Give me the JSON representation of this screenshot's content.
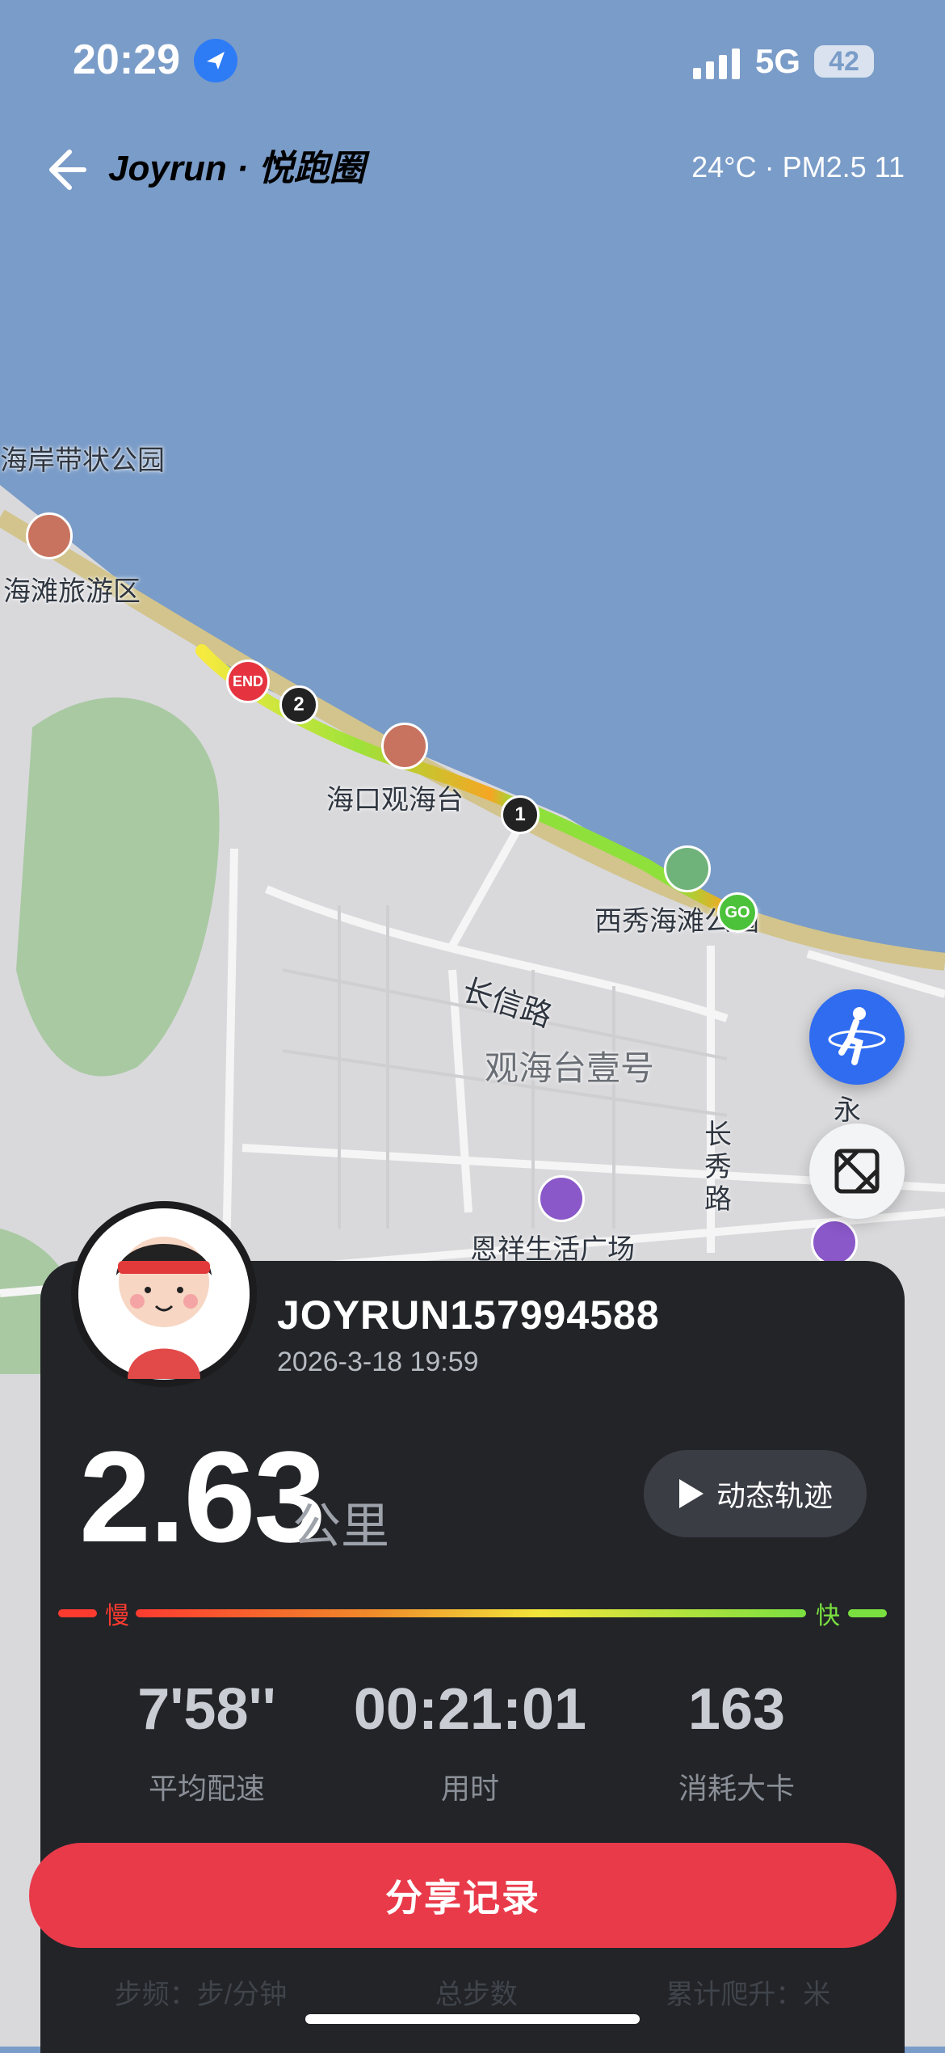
{
  "status_bar": {
    "time": "20:29",
    "network": "5G",
    "battery": "42"
  },
  "header": {
    "brand": "Joyrun · 悦跑圈",
    "weather": "24°C  ·  PM2.5 11"
  },
  "map": {
    "labels": [
      "海岸带状公园",
      "海滩旅游区",
      "海口观海台",
      "西秀海滩公园",
      "长信路",
      "观海台壹号",
      "长秀路",
      "恩祥生活广场",
      "永"
    ],
    "markers": {
      "start": "GO",
      "end": "END",
      "km1": "1",
      "km2": "2"
    }
  },
  "card": {
    "username": "JOYRUN157994588",
    "datetime": "2026-3-18 19:59",
    "distance": "2.63",
    "distance_unit": "公里",
    "replay_label": "动态轨迹",
    "pace_scale": {
      "slow": "慢",
      "fast": "快"
    },
    "stats": [
      {
        "value": "7'58''",
        "label": "平均配速"
      },
      {
        "value": "00:21:01",
        "label": "用时"
      },
      {
        "value": "163",
        "label": "消耗大卡"
      }
    ],
    "share_label": "分享记录",
    "extra_stats": [
      "步频：步/分钟",
      "总步数",
      "累计爬升：米"
    ]
  },
  "colors": {
    "accent": "#e93a4a",
    "card_bg": "#222428",
    "slow": "#ff3b30",
    "fast": "#7ae040"
  }
}
